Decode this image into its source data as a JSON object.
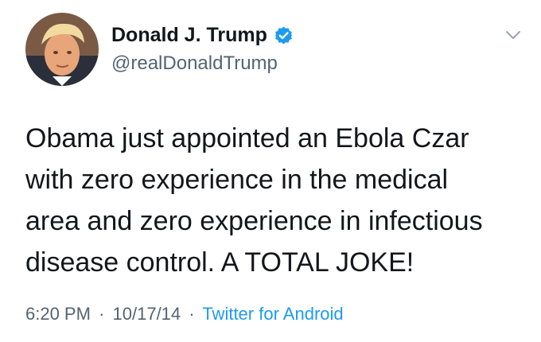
{
  "user": {
    "display_name": "Donald J. Trump",
    "handle": "@realDonaldTrump",
    "verified": true,
    "avatar_icon": "profile-photo"
  },
  "tweet": {
    "text": "Obama just appointed an Ebola Czar\nwith zero experience in the medical\narea and zero experience in infectious\ndisease control. A TOTAL JOKE!",
    "time": "6:20 PM",
    "date": "10/17/14",
    "source": "Twitter for Android",
    "separator": "·"
  },
  "icons": {
    "verified": "verified-badge-icon",
    "menu": "chevron-down-icon"
  },
  "colors": {
    "text": "#14171a",
    "secondary": "#536471",
    "accent": "#1d9bf0"
  }
}
